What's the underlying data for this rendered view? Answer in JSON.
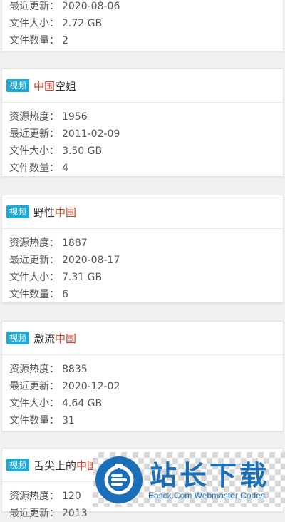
{
  "badge_label": "视频",
  "cards": [
    {
      "title_parts": [],
      "rows": [
        {
          "k": "最近更新：",
          "v": "2020-08-06"
        },
        {
          "k": "文件大小：",
          "v": "2.72 GB"
        },
        {
          "k": "文件数量：",
          "v": "2"
        }
      ]
    },
    {
      "title_parts": [
        {
          "t": "中国",
          "hl": true
        },
        {
          "t": "空姐",
          "hl": false
        }
      ],
      "rows": [
        {
          "k": "资源热度：",
          "v": "1956"
        },
        {
          "k": "最近更新：",
          "v": "2011-02-09"
        },
        {
          "k": "文件大小：",
          "v": "3.50 GB"
        },
        {
          "k": "文件数量：",
          "v": "4"
        }
      ]
    },
    {
      "title_parts": [
        {
          "t": "野性",
          "hl": false
        },
        {
          "t": "中国",
          "hl": true
        }
      ],
      "rows": [
        {
          "k": "资源热度：",
          "v": "1887"
        },
        {
          "k": "最近更新：",
          "v": "2020-08-17"
        },
        {
          "k": "文件大小：",
          "v": "7.31 GB"
        },
        {
          "k": "文件数量：",
          "v": "6"
        }
      ]
    },
    {
      "title_parts": [
        {
          "t": "激流",
          "hl": false
        },
        {
          "t": "中国",
          "hl": true
        }
      ],
      "rows": [
        {
          "k": "资源热度：",
          "v": "8835"
        },
        {
          "k": "最近更新：",
          "v": "2020-12-02"
        },
        {
          "k": "文件大小：",
          "v": "4.64 GB"
        },
        {
          "k": "文件数量：",
          "v": "31"
        }
      ]
    },
    {
      "title_parts": [
        {
          "t": "舌尖上的",
          "hl": false
        },
        {
          "t": "中国",
          "hl": true
        }
      ],
      "rows": [
        {
          "k": "资源热度：",
          "v": "120"
        },
        {
          "k": "最近更新：",
          "v": "2013"
        }
      ]
    }
  ],
  "watermark": {
    "title": "站长下载",
    "subtitle": "Easck.Com Webmaster Codes",
    "color": "#1a6fb8"
  },
  "colors": {
    "badge": "#1ea8d6",
    "highlight": "#d0452d"
  },
  "icons": {
    "watermark_logo": "easck-logo-icon"
  }
}
